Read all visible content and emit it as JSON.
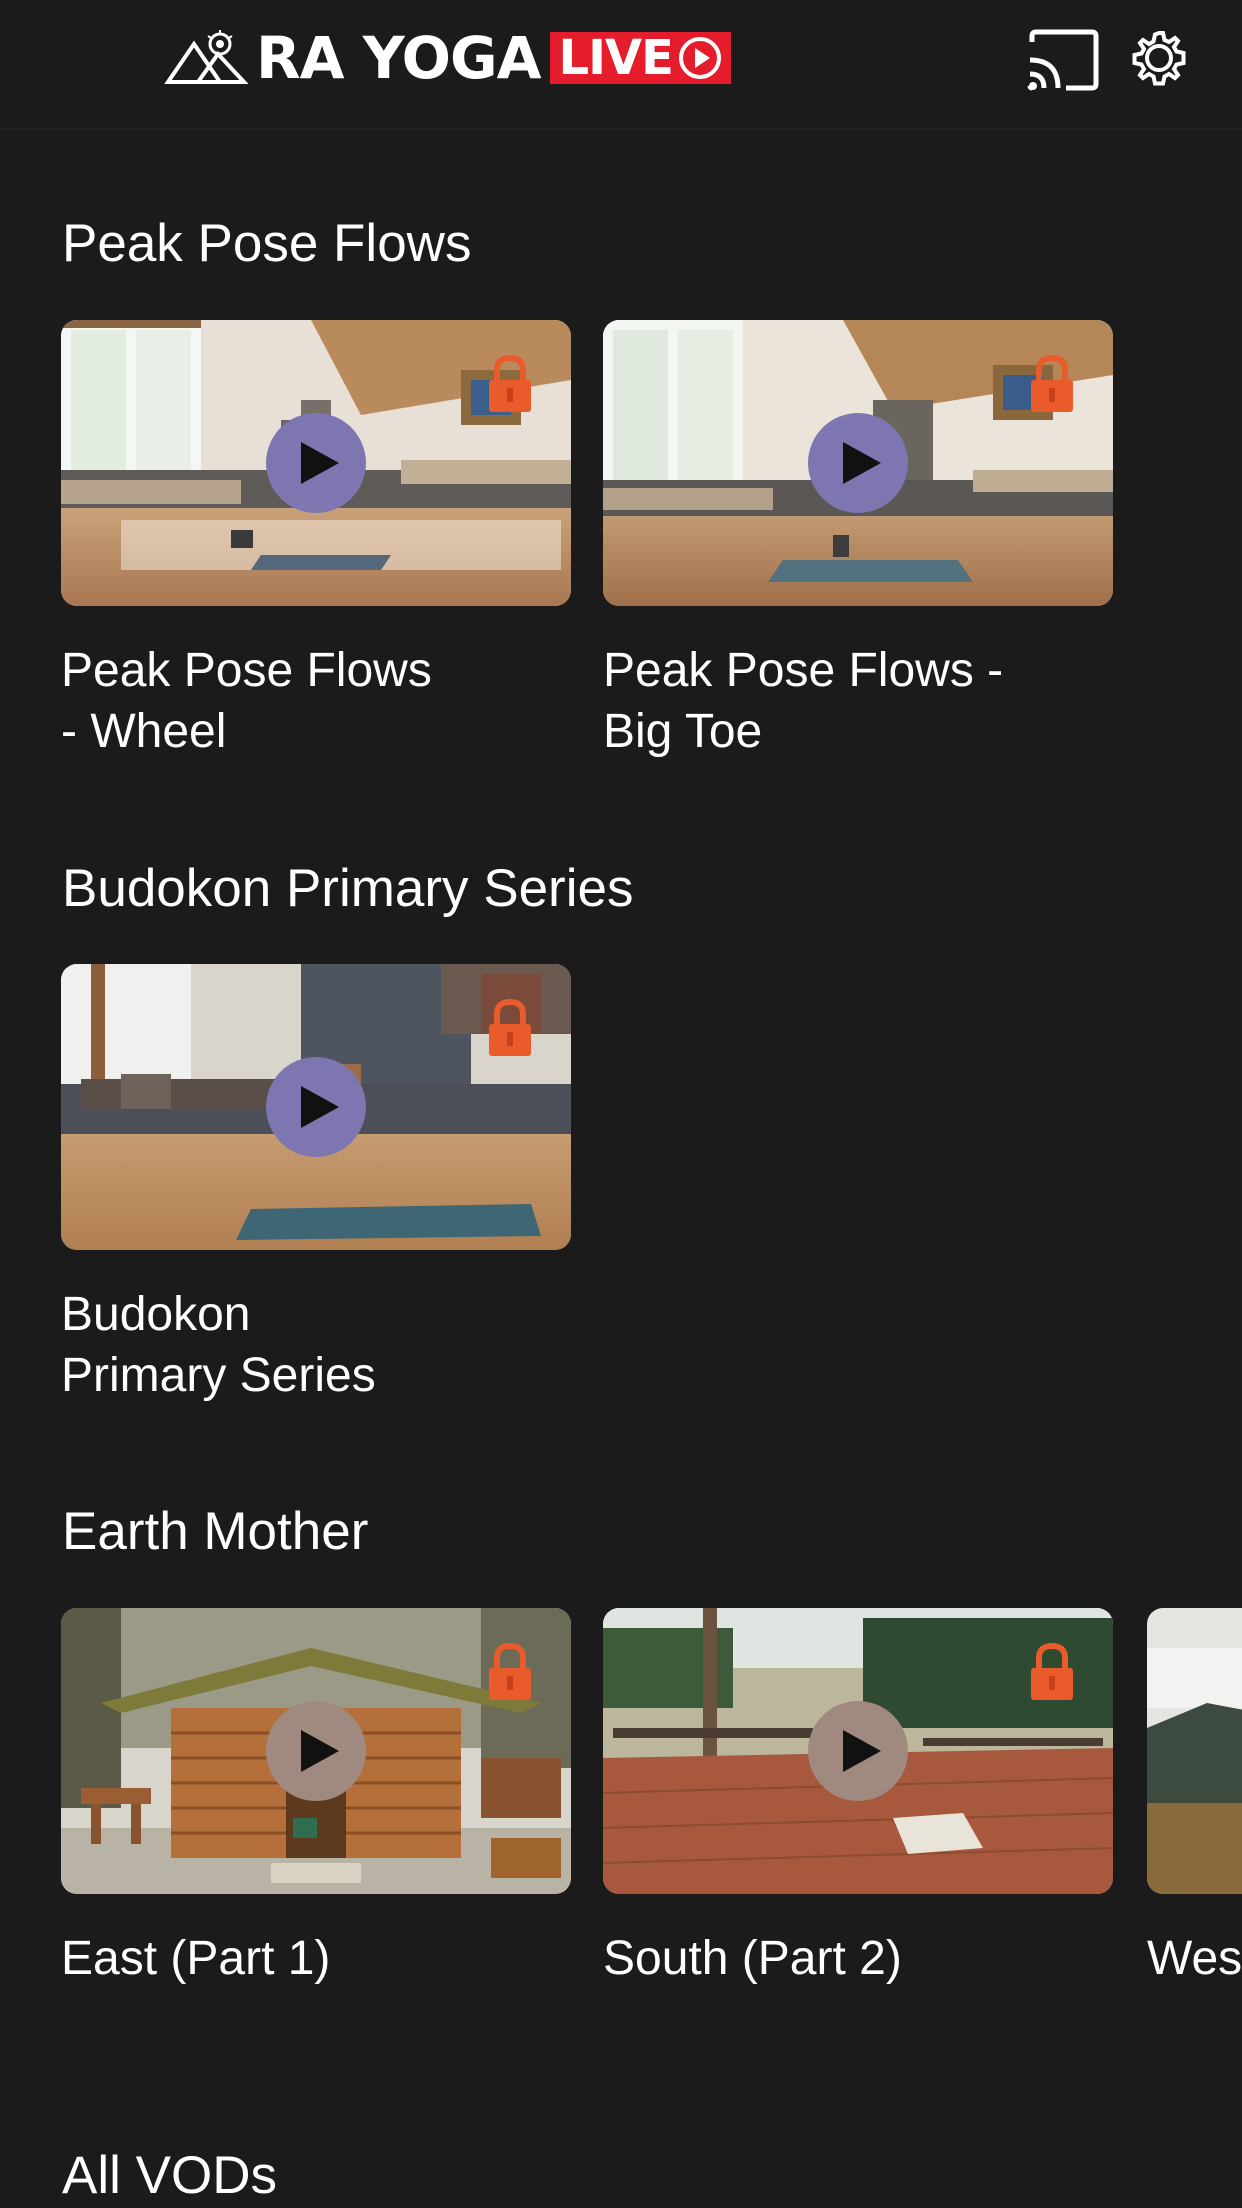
{
  "header": {
    "logo_text": "RA YOGA",
    "logo_live": "LIVE",
    "cast_icon": "cast-icon",
    "settings_icon": "gear-icon"
  },
  "colors": {
    "background": "#1b1b1c",
    "lock": "#ea5b2c",
    "live_badge": "#e51c2c",
    "play_purple": "#7d76b0",
    "play_tan": "#a08a80"
  },
  "sections": [
    {
      "title": "Peak Pose Flows",
      "cards": [
        {
          "title": "Peak Pose Flows\n- Wheel",
          "locked": true
        },
        {
          "title": "Peak Pose Flows -\nBig Toe",
          "locked": true
        }
      ]
    },
    {
      "title": "Budokon Primary Series",
      "cards": [
        {
          "title": "Budokon\nPrimary Series",
          "locked": true
        }
      ]
    },
    {
      "title": "Earth Mother",
      "cards": [
        {
          "title": "East (Part 1)",
          "locked": true
        },
        {
          "title": "South (Part 2)",
          "locked": true
        },
        {
          "title": "Wes",
          "locked": false
        }
      ]
    },
    {
      "title": "All VODs",
      "cards": []
    }
  ]
}
